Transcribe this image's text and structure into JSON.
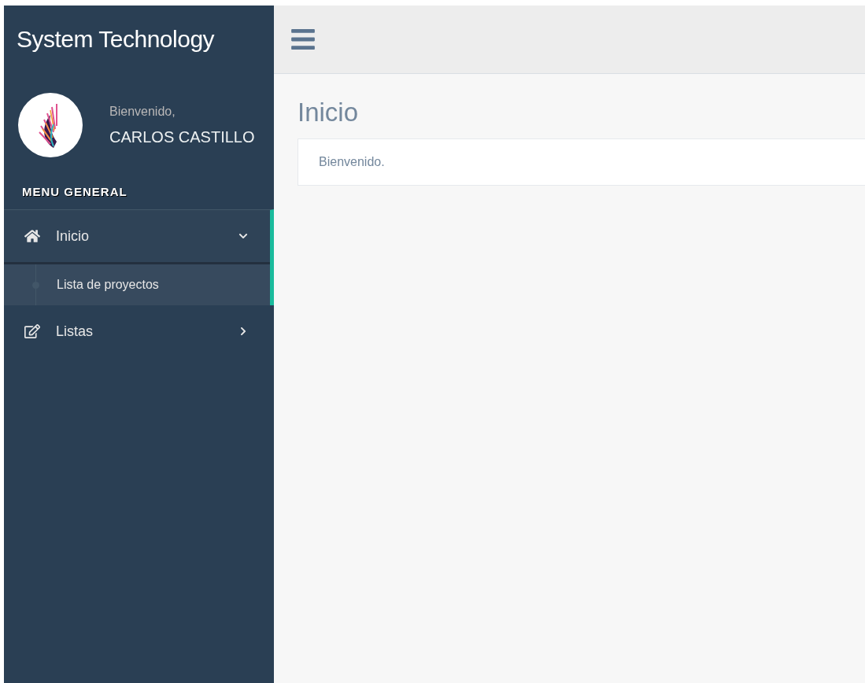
{
  "sidebar": {
    "brand": "System Technology",
    "profile": {
      "greeting": "Bienvenido,",
      "name": "CARLOS CASTILLO"
    },
    "section_title": "MENU GENERAL",
    "items": [
      {
        "label": "Inicio",
        "expanded": true,
        "active": true,
        "children": [
          {
            "label": "Lista de proyectos",
            "selected": true
          }
        ]
      },
      {
        "label": "Listas",
        "expanded": false,
        "active": false
      }
    ]
  },
  "page": {
    "title": "Inicio",
    "message": "Bienvenido."
  }
}
